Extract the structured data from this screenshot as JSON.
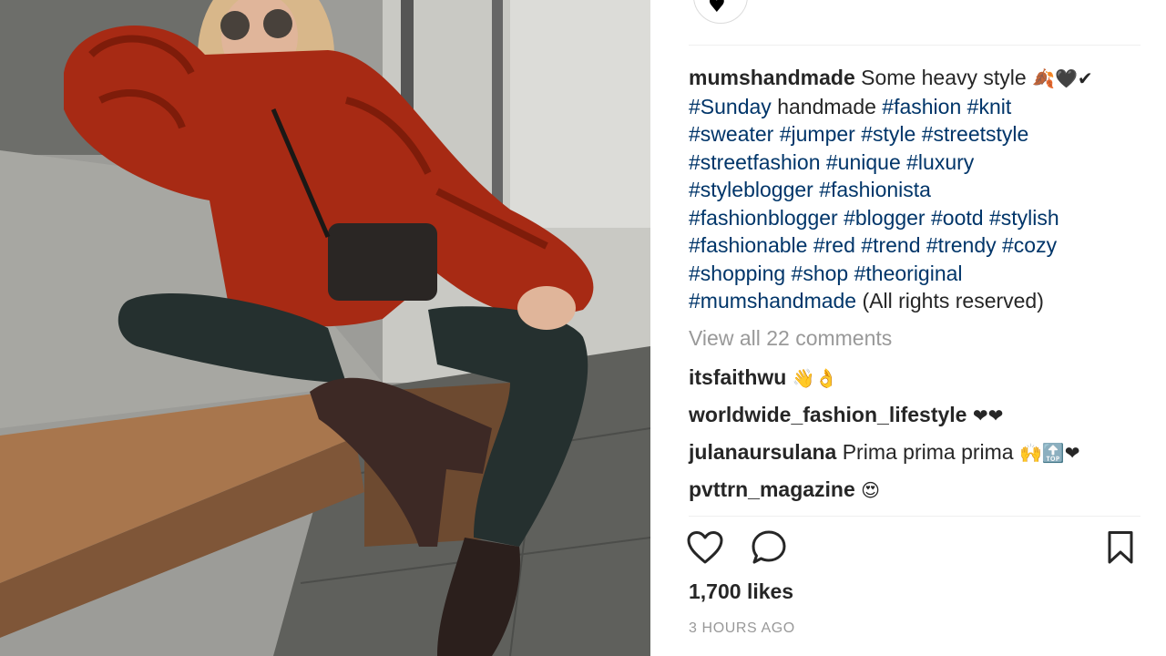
{
  "post": {
    "username": "mumshandmade",
    "caption_text": "Some heavy style",
    "caption_emoji": "🍂🖤✔",
    "caption_lines": [
      [
        {
          "t": "#Sunday",
          "tag": true
        },
        {
          "t": " handmade ",
          "tag": false
        },
        {
          "t": "#fashion",
          "tag": true
        },
        {
          "t": " ",
          "tag": false
        },
        {
          "t": "#knit",
          "tag": true
        }
      ],
      [
        {
          "t": "#sweater",
          "tag": true
        },
        {
          "t": " ",
          "tag": false
        },
        {
          "t": "#jumper",
          "tag": true
        },
        {
          "t": " ",
          "tag": false
        },
        {
          "t": "#style",
          "tag": true
        },
        {
          "t": " ",
          "tag": false
        },
        {
          "t": "#streetstyle",
          "tag": true
        }
      ],
      [
        {
          "t": "#streetfashion",
          "tag": true
        },
        {
          "t": " ",
          "tag": false
        },
        {
          "t": "#unique",
          "tag": true
        },
        {
          "t": " ",
          "tag": false
        },
        {
          "t": "#luxury",
          "tag": true
        }
      ],
      [
        {
          "t": "#styleblogger",
          "tag": true
        },
        {
          "t": " ",
          "tag": false
        },
        {
          "t": "#fashionista",
          "tag": true
        }
      ],
      [
        {
          "t": "#fashionblogger",
          "tag": true
        },
        {
          "t": " ",
          "tag": false
        },
        {
          "t": "#blogger",
          "tag": true
        },
        {
          "t": " ",
          "tag": false
        },
        {
          "t": "#ootd",
          "tag": true
        },
        {
          "t": " ",
          "tag": false
        },
        {
          "t": "#stylish",
          "tag": true
        }
      ],
      [
        {
          "t": "#fashionable",
          "tag": true
        },
        {
          "t": " ",
          "tag": false
        },
        {
          "t": "#red",
          "tag": true
        },
        {
          "t": " ",
          "tag": false
        },
        {
          "t": "#trend",
          "tag": true
        },
        {
          "t": " ",
          "tag": false
        },
        {
          "t": "#trendy",
          "tag": true
        },
        {
          "t": " ",
          "tag": false
        },
        {
          "t": "#cozy",
          "tag": true
        }
      ],
      [
        {
          "t": "#shopping",
          "tag": true
        },
        {
          "t": " ",
          "tag": false
        },
        {
          "t": "#shop",
          "tag": true
        },
        {
          "t": " ",
          "tag": false
        },
        {
          "t": "#theoriginal",
          "tag": true
        }
      ],
      [
        {
          "t": "#mumshandmade",
          "tag": true
        },
        {
          "t": " (All rights reserved)",
          "tag": false
        }
      ]
    ],
    "view_all_comments": "View all 22 comments",
    "comments": [
      {
        "user": "itsfaithwu",
        "text": "",
        "emoji": "👋👌"
      },
      {
        "user": "worldwide_fashion_lifestyle",
        "text": "",
        "emoji": "❤❤"
      },
      {
        "user": "julanaursulana",
        "text": "Prima prima prima",
        "emoji": "🙌🔝❤"
      },
      {
        "user": "pvttrn_magazine",
        "text": "",
        "emoji": "😍"
      }
    ],
    "likes": "1,700 likes",
    "time_ago": "3 HOURS AGO",
    "avatar_icon": "heart-icon"
  },
  "colors": {
    "hashtag": "#003569",
    "text": "#262626",
    "muted": "#999999",
    "sweater": "#a72a14"
  }
}
